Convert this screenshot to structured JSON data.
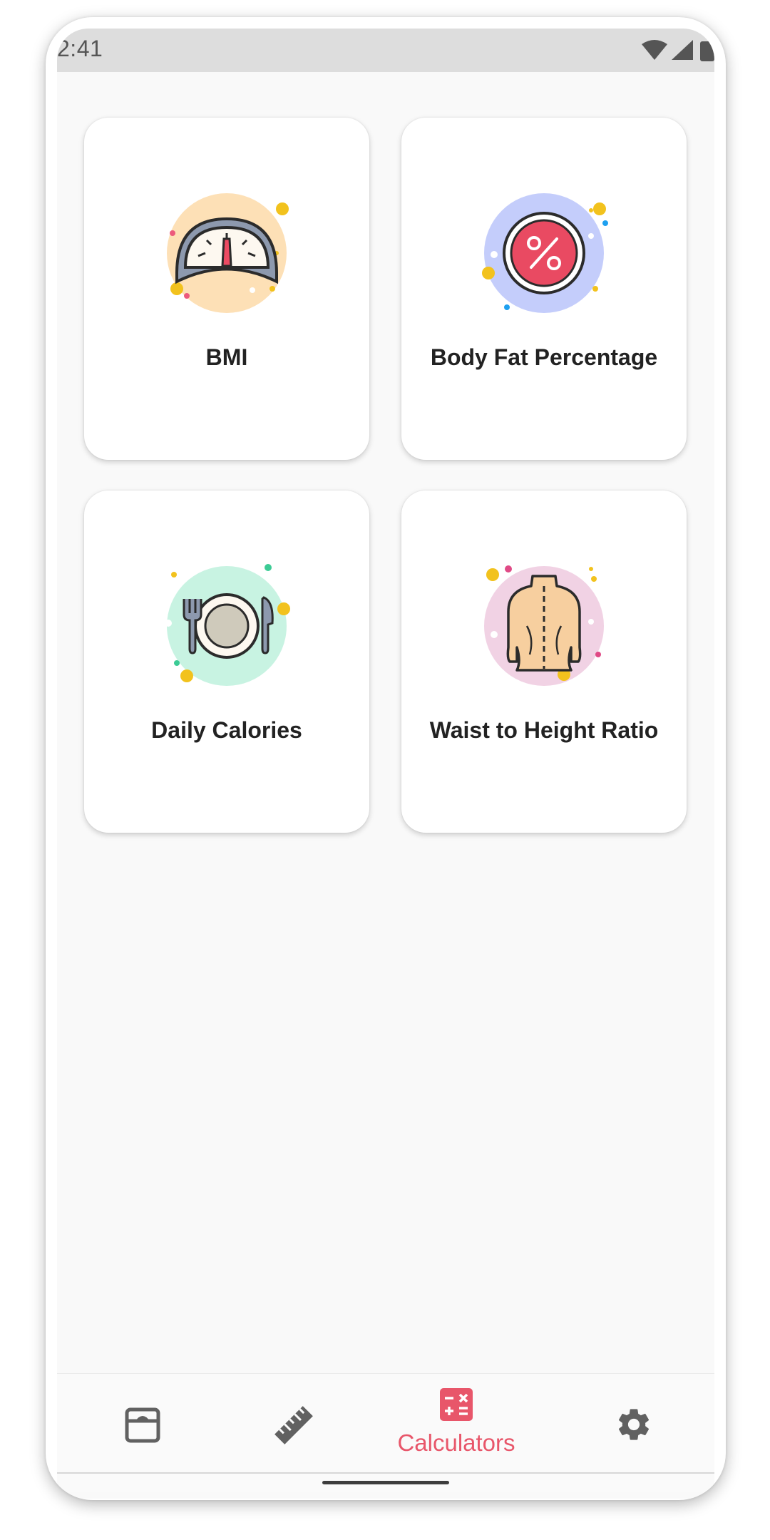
{
  "status_bar": {
    "time": "2:41"
  },
  "cards": [
    {
      "label": "BMI",
      "icon": "scale-gauge-icon"
    },
    {
      "label": "Body Fat Percentage",
      "icon": "percent-icon"
    },
    {
      "label": "Daily Calories",
      "icon": "plate-cutlery-icon"
    },
    {
      "label": "Waist to Height Ratio",
      "icon": "torso-icon"
    }
  ],
  "bottom_nav": {
    "items": [
      {
        "icon": "scale-icon",
        "label": ""
      },
      {
        "icon": "ruler-icon",
        "label": ""
      },
      {
        "icon": "calculator-icon",
        "label": "Calculators",
        "active": true
      },
      {
        "icon": "gear-icon",
        "label": ""
      }
    ]
  },
  "colors": {
    "accent": "#e8566a",
    "nav_icon": "#616161",
    "card_bg": "#ffffff",
    "screen_bg": "#f9f9f9"
  }
}
